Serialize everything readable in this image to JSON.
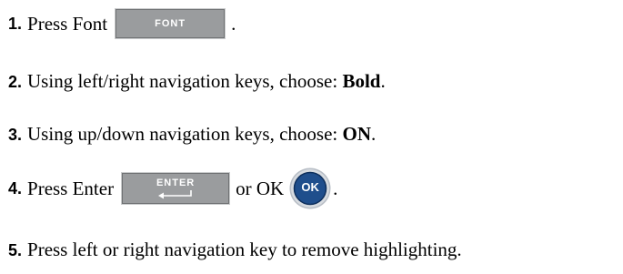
{
  "steps": [
    {
      "number": "1.",
      "text_before": "Press Font",
      "key_label": "FONT",
      "text_after": "."
    },
    {
      "number": "2.",
      "text_before": "Using left/right navigation keys, choose: ",
      "bold": "Bold",
      "text_after": "."
    },
    {
      "number": "3.",
      "text_before": "Using up/down navigation keys, choose: ",
      "bold": "ON",
      "text_after": "."
    },
    {
      "number": "4.",
      "text_before": "Press Enter",
      "key_label": "ENTER",
      "text_middle": "or OK",
      "ok_label": "OK",
      "text_after": "."
    },
    {
      "number": "5.",
      "text_before": "Press left or right navigation key to remove highlighting."
    }
  ],
  "colors": {
    "key_face": "#9a9c9e",
    "ok_ring": "#b8bec6",
    "ok_face": "#1f4e8c"
  },
  "icons": {
    "enter_key": "enter-arrow-icon",
    "ok_button": "ok-button-icon"
  }
}
